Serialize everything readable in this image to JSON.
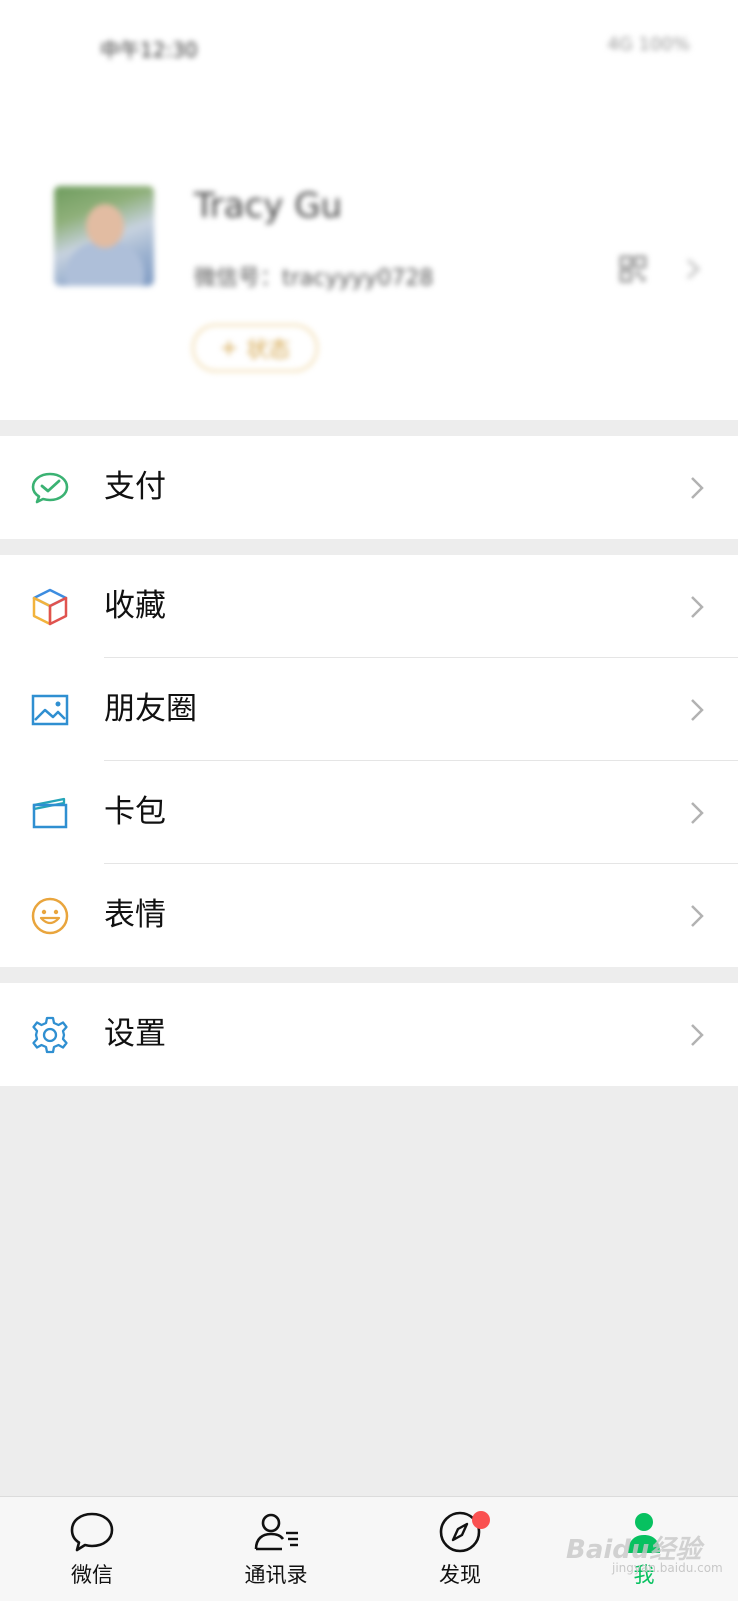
{
  "status_bar": {
    "left_text": "中午12:30",
    "right_text": "4G 100%"
  },
  "profile": {
    "nickname": "Tracy Gu",
    "wechat_id": "微信号：tracyyyy0728",
    "status_label": "状态"
  },
  "menu": {
    "pay": {
      "label": "支付",
      "icon": "wechat-pay-icon"
    },
    "favorites": {
      "label": "收藏",
      "icon": "favorites-cube-icon"
    },
    "moments": {
      "label": "朋友圈",
      "icon": "moments-image-icon"
    },
    "cards": {
      "label": "卡包",
      "icon": "card-wallet-icon"
    },
    "stickers": {
      "label": "表情",
      "icon": "smiley-icon"
    },
    "settings": {
      "label": "设置",
      "icon": "gear-icon"
    }
  },
  "tabbar": {
    "tabs": [
      {
        "label": "微信",
        "icon": "chat-bubble-icon",
        "active": false
      },
      {
        "label": "通讯录",
        "icon": "contacts-icon",
        "active": false
      },
      {
        "label": "发现",
        "icon": "compass-icon",
        "active": false,
        "badge": true
      },
      {
        "label": "我",
        "icon": "person-icon",
        "active": true
      }
    ]
  },
  "watermark": {
    "text": "Baidu经验",
    "sub": "jingyan.baidu.com"
  },
  "colors": {
    "accent": "#07c160",
    "badge": "#fa5151",
    "background": "#ededed"
  }
}
